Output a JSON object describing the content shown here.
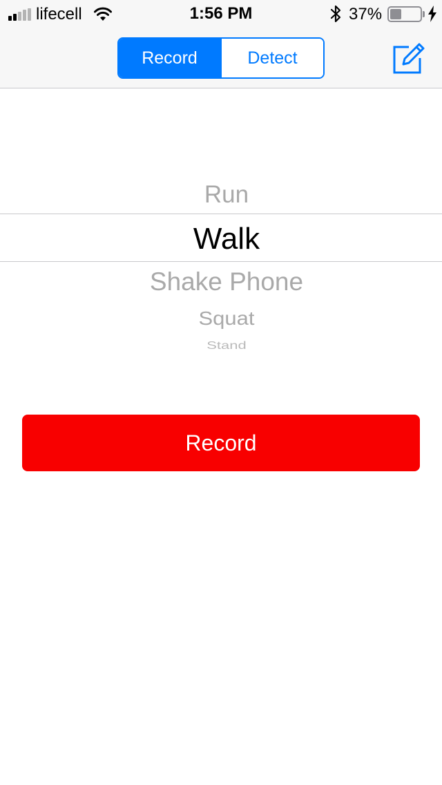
{
  "status_bar": {
    "carrier": "lifecell",
    "time": "1:56 PM",
    "battery_percent_text": "37%",
    "battery_level": 0.37,
    "signal_bars_filled": 2,
    "signal_bars_total": 5,
    "icons": [
      "signal-icon",
      "wifi-icon",
      "bluetooth-icon",
      "battery-icon",
      "charging-bolt-icon"
    ]
  },
  "nav_bar": {
    "segments": [
      {
        "label": "Record",
        "selected": true
      },
      {
        "label": "Detect",
        "selected": false
      }
    ],
    "compose_icon": "compose-icon"
  },
  "picker": {
    "items": [
      "Run",
      "Walk",
      "Shake Phone",
      "Squat",
      "Stand"
    ],
    "selected": "Walk"
  },
  "record_button": {
    "label": "Record"
  },
  "colors": {
    "accent": "#007aff",
    "record_button": "#f80000",
    "picker_inactive_text": "#a9a9a9",
    "topbar_background": "#f7f7f7"
  }
}
